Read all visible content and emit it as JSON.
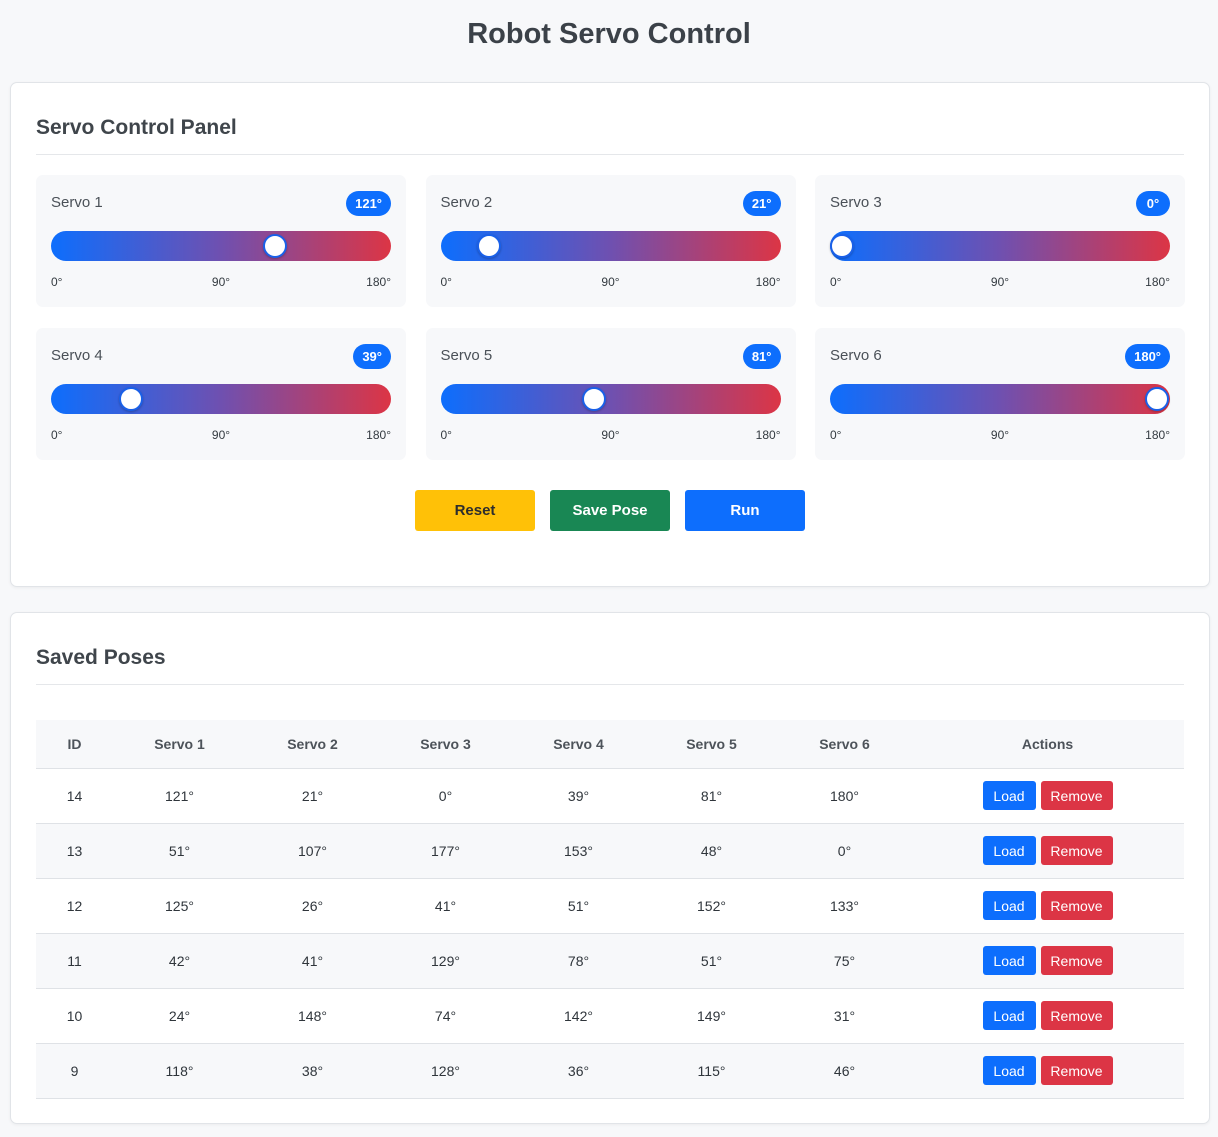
{
  "page_title": "Robot Servo Control",
  "control_panel": {
    "title": "Servo Control Panel",
    "servos": [
      {
        "name": "Servo 1",
        "badge": "121°",
        "value": 121,
        "tick_min": "0°",
        "tick_mid": "90°",
        "tick_max": "180°"
      },
      {
        "name": "Servo 2",
        "badge": "21°",
        "value": 21,
        "tick_min": "0°",
        "tick_mid": "90°",
        "tick_max": "180°"
      },
      {
        "name": "Servo 3",
        "badge": "0°",
        "value": 0,
        "tick_min": "0°",
        "tick_mid": "90°",
        "tick_max": "180°"
      },
      {
        "name": "Servo 4",
        "badge": "39°",
        "value": 39,
        "tick_min": "0°",
        "tick_mid": "90°",
        "tick_max": "180°"
      },
      {
        "name": "Servo 5",
        "badge": "81°",
        "value": 81,
        "tick_min": "0°",
        "tick_mid": "90°",
        "tick_max": "180°"
      },
      {
        "name": "Servo 6",
        "badge": "180°",
        "value": 180,
        "tick_min": "0°",
        "tick_mid": "90°",
        "tick_max": "180°"
      }
    ],
    "slider_max": 180,
    "buttons": {
      "reset": "Reset",
      "save_pose": "Save Pose",
      "run": "Run"
    }
  },
  "saved_poses": {
    "title": "Saved Poses",
    "columns": [
      "ID",
      "Servo 1",
      "Servo 2",
      "Servo 3",
      "Servo 4",
      "Servo 5",
      "Servo 6",
      "Actions"
    ],
    "load_label": "Load",
    "remove_label": "Remove",
    "rows": [
      {
        "id": "14",
        "s": [
          "121°",
          "21°",
          "0°",
          "39°",
          "81°",
          "180°"
        ]
      },
      {
        "id": "13",
        "s": [
          "51°",
          "107°",
          "177°",
          "153°",
          "48°",
          "0°"
        ]
      },
      {
        "id": "12",
        "s": [
          "125°",
          "26°",
          "41°",
          "51°",
          "152°",
          "133°"
        ]
      },
      {
        "id": "11",
        "s": [
          "42°",
          "41°",
          "129°",
          "78°",
          "51°",
          "75°"
        ]
      },
      {
        "id": "10",
        "s": [
          "24°",
          "148°",
          "74°",
          "142°",
          "149°",
          "31°"
        ]
      },
      {
        "id": "9",
        "s": [
          "118°",
          "38°",
          "128°",
          "36°",
          "115°",
          "46°"
        ]
      }
    ]
  },
  "colors": {
    "primary": "#0d6efd",
    "warning": "#ffc107",
    "success": "#198754",
    "danger": "#dc3545"
  }
}
